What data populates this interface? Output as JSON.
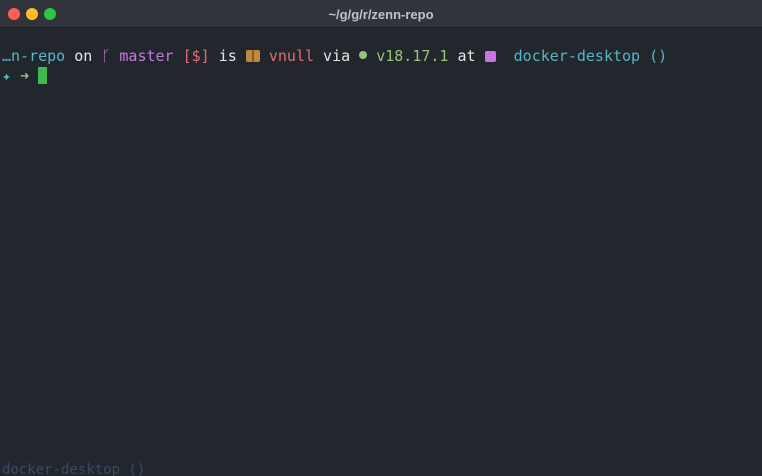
{
  "window": {
    "title": "~/g/g/r/zenn-repo"
  },
  "prompt": {
    "dir": "…n-repo",
    "on": "on",
    "branch_icon": "git-branch-icon",
    "branch": "master",
    "status": "[$]",
    "is": "is",
    "package_icon": "package-icon",
    "package_version": "vnull",
    "via": "via",
    "node_icon": "nodejs-icon",
    "node_version": "v18.17.1",
    "at": "at",
    "k8s_icon": "kubernetes-icon",
    "context": "docker-desktop",
    "parens": "()",
    "symbol": "✦",
    "arrow": "➜"
  },
  "bottom_fragment": "docker-desktop ()",
  "colors": {
    "background": "#22272e",
    "titlebar": "#31353b",
    "cyan": "#56b6c2",
    "purple": "#c678dd",
    "red": "#e06c75",
    "green": "#98c379",
    "cursor": "#3fb950"
  }
}
